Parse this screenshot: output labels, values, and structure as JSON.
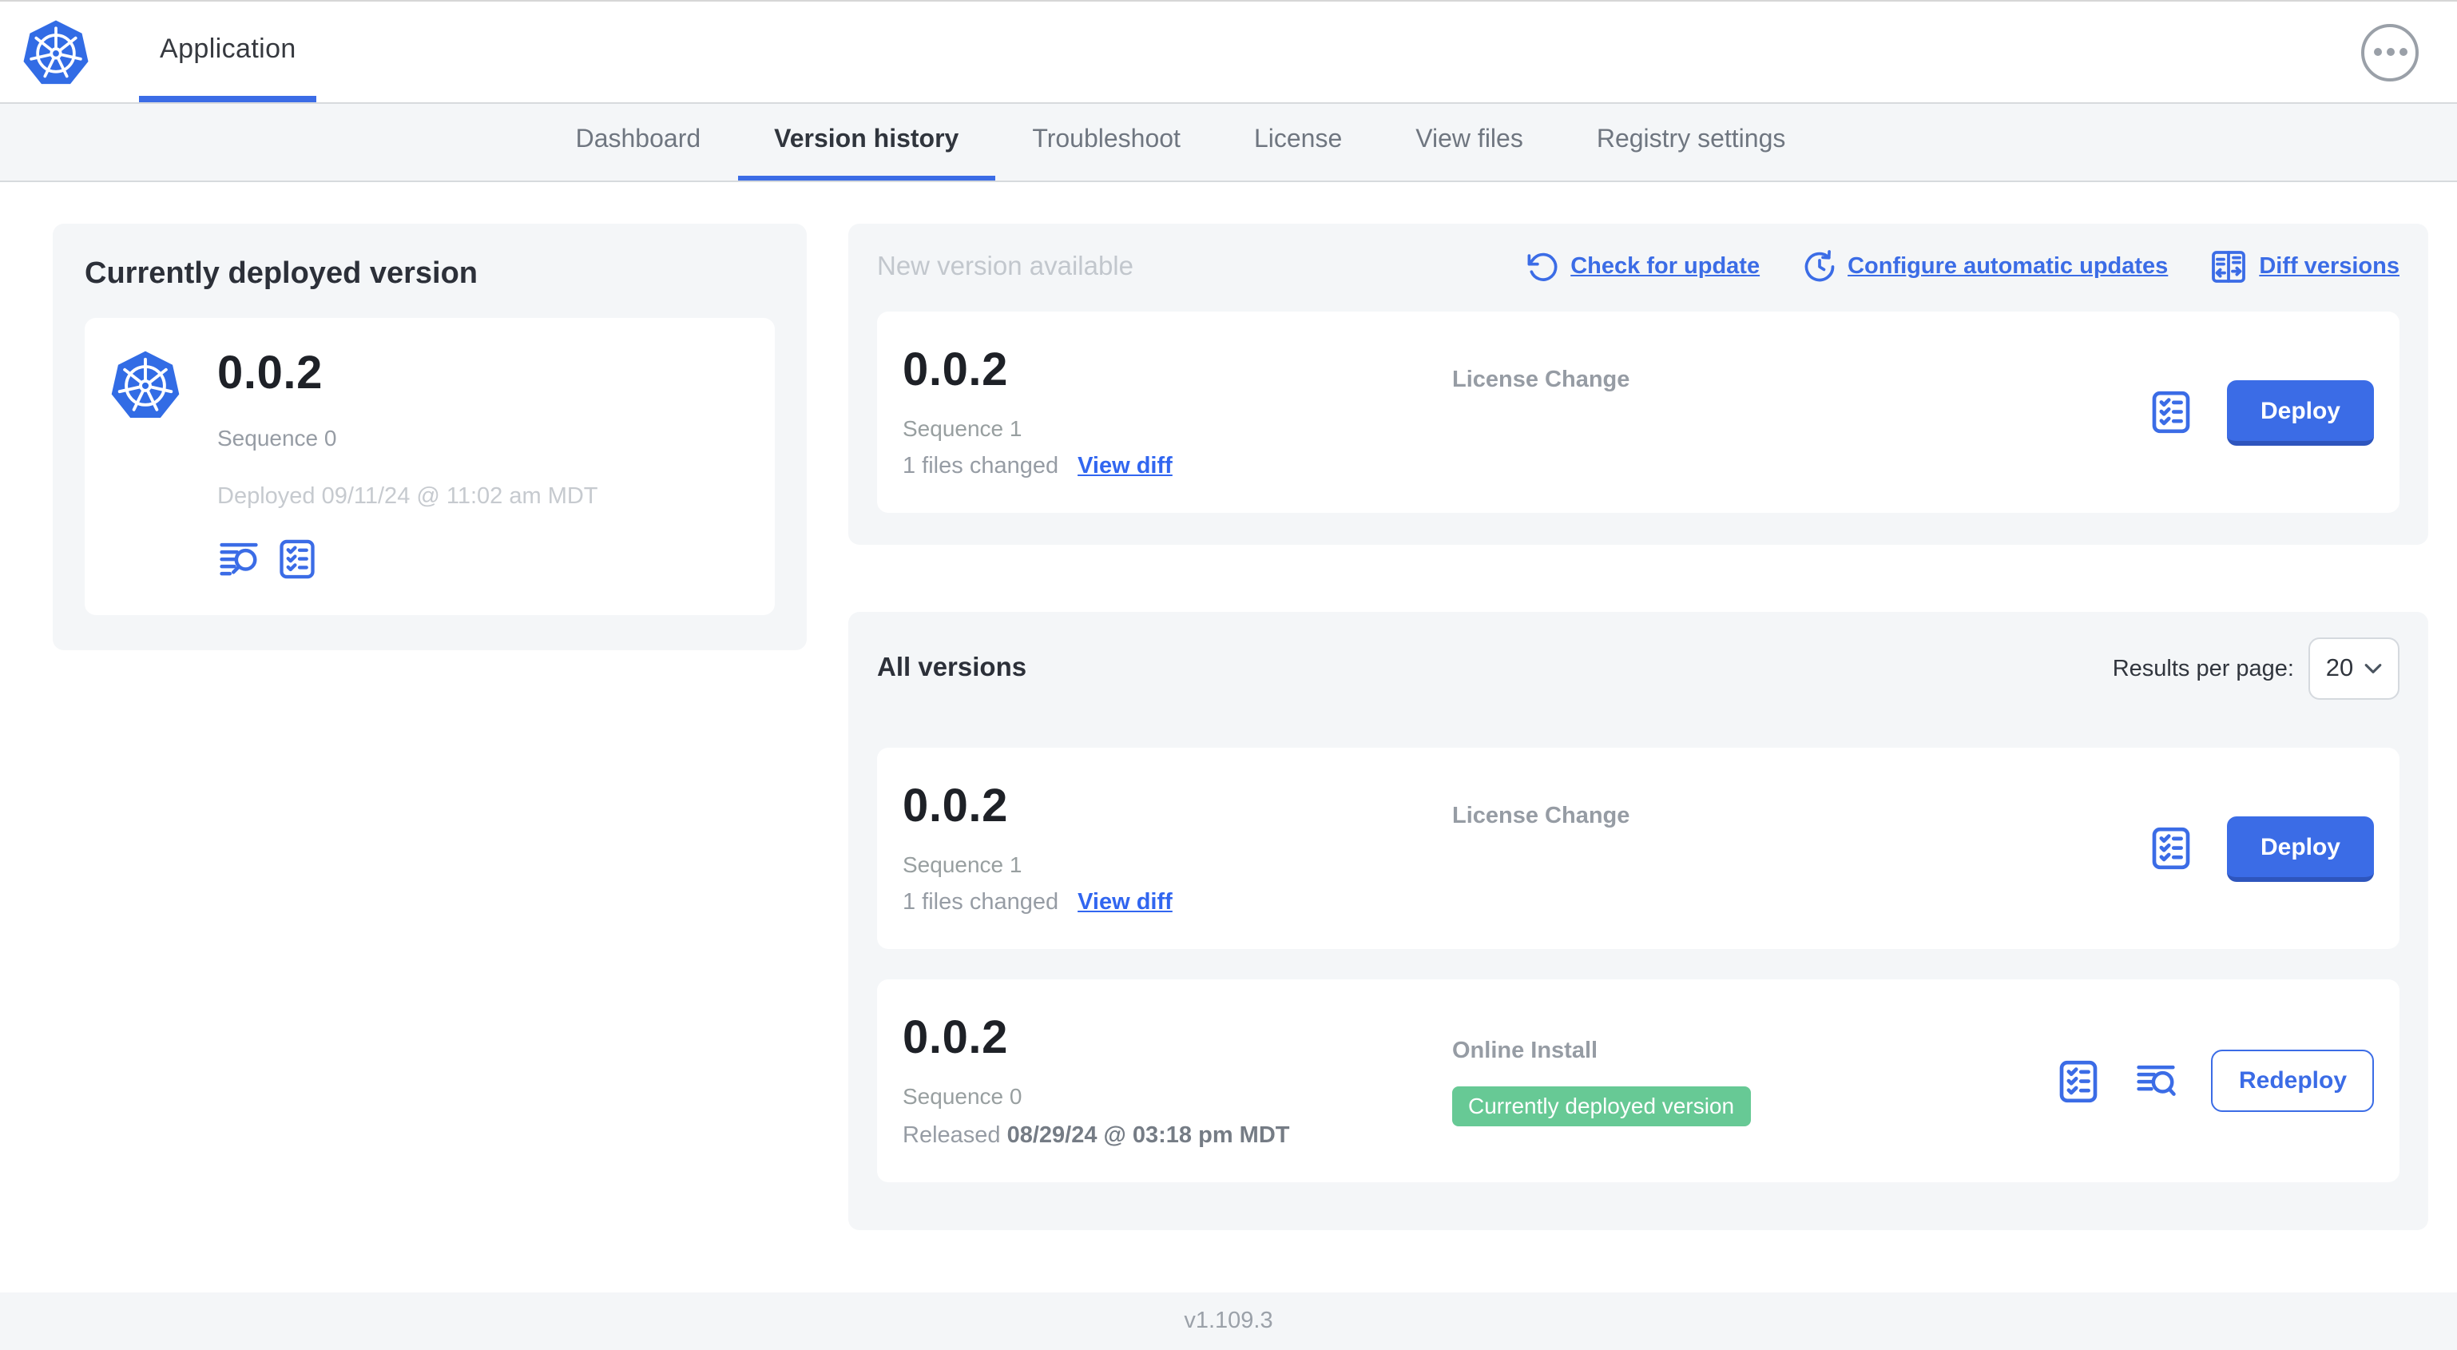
{
  "header": {
    "app_title": "Application"
  },
  "nav": {
    "tabs": [
      {
        "label": "Dashboard"
      },
      {
        "label": "Version history"
      },
      {
        "label": "Troubleshoot"
      },
      {
        "label": "License"
      },
      {
        "label": "View files"
      },
      {
        "label": "Registry settings"
      }
    ]
  },
  "current_version": {
    "title": "Currently deployed version",
    "version": "0.0.2",
    "sequence": "Sequence 0",
    "deployed": "Deployed 09/11/24 @ 11:02 am MDT",
    "icons": [
      "logs-icon",
      "preflight-icon"
    ]
  },
  "new_version": {
    "heading": "New version available",
    "actions": [
      {
        "label": "Check for update",
        "icon": "refresh-icon"
      },
      {
        "label": "Configure automatic updates",
        "icon": "schedule-icon"
      },
      {
        "label": "Diff versions",
        "icon": "diff-icon"
      }
    ],
    "card": {
      "version": "0.0.2",
      "sequence": "Sequence 1",
      "files_changed": "1 files changed",
      "view_diff": "View diff",
      "source": "License Change",
      "deploy_label": "Deploy"
    }
  },
  "all_versions": {
    "heading": "All versions",
    "results_per_page_label": "Results per page:",
    "results_per_page_value": "20",
    "rows": [
      {
        "version": "0.0.2",
        "sequence": "Sequence 1",
        "files_changed": "1 files changed",
        "view_diff": "View diff",
        "source": "License Change",
        "action_label": "Deploy"
      },
      {
        "version": "0.0.2",
        "sequence": "Sequence 0",
        "released_label": "Released",
        "released_value": "08/29/24 @ 03:18 pm MDT",
        "source": "Online Install",
        "badge": "Currently deployed version",
        "action_label": "Redeploy"
      }
    ]
  },
  "footer": {
    "app_version": "v1.109.3"
  },
  "colors": {
    "accent_blue": "#3b6ce6",
    "badge_green": "#67c995",
    "panel_gray": "#f4f6f8"
  }
}
